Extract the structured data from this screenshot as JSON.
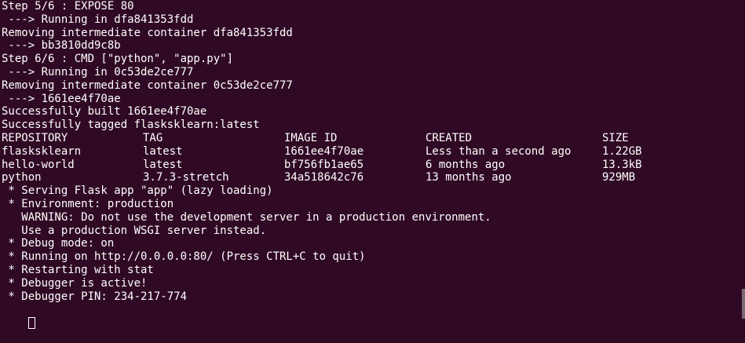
{
  "terminal": {
    "build_lines": [
      "Step 5/6 : EXPOSE 80",
      " ---> Running in dfa841353fdd",
      "Removing intermediate container dfa841353fdd",
      " ---> bb3810dd9c8b",
      "Step 6/6 : CMD [\"python\", \"app.py\"]",
      " ---> Running in 0c53de2ce777",
      "Removing intermediate container 0c53de2ce777",
      " ---> 1661ee4f70ae",
      "Successfully built 1661ee4f70ae",
      "Successfully tagged flasksklearn:latest"
    ],
    "images_table": {
      "headers": [
        "REPOSITORY",
        "TAG",
        "IMAGE ID",
        "CREATED",
        "SIZE"
      ],
      "rows": [
        [
          "flasksklearn",
          "latest",
          "1661ee4f70ae",
          "Less than a second ago",
          "1.22GB"
        ],
        [
          "hello-world",
          "latest",
          "bf756fb1ae65",
          "6 months ago",
          "13.3kB"
        ],
        [
          "python",
          "3.7.3-stretch",
          "34a518642c76",
          "13 months ago",
          "929MB"
        ]
      ]
    },
    "flask_lines": [
      " * Serving Flask app \"app\" (lazy loading)",
      " * Environment: production",
      "   WARNING: Do not use the development server in a production environment.",
      "   Use a production WSGI server instead.",
      " * Debug mode: on",
      " * Running on http://0.0.0.0:80/ (Press CTRL+C to quit)",
      " * Restarting with stat",
      " * Debugger is active!",
      " * Debugger PIN: 234-217-774"
    ]
  },
  "colors": {
    "background": "#300a24",
    "foreground": "#ffffff"
  }
}
